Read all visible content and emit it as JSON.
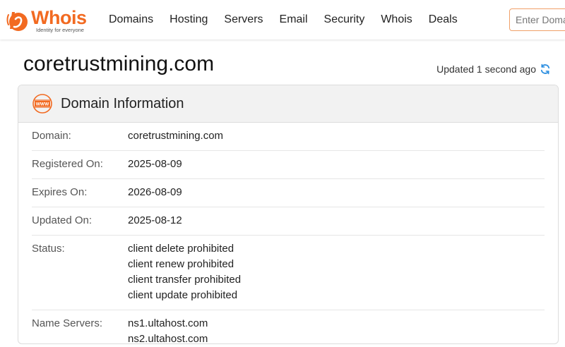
{
  "brand": {
    "name": "Whois",
    "tagline": "Identity for everyone",
    "accent_color": "#f26a21"
  },
  "nav": {
    "items": [
      {
        "label": "Domains"
      },
      {
        "label": "Hosting"
      },
      {
        "label": "Servers"
      },
      {
        "label": "Email"
      },
      {
        "label": "Security"
      },
      {
        "label": "Whois"
      },
      {
        "label": "Deals"
      }
    ],
    "search_placeholder": "Enter Domain"
  },
  "page": {
    "title": "coretrustmining.com",
    "updated_text": "Updated 1 second ago",
    "refresh_icon": "refresh-icon"
  },
  "card": {
    "title": "Domain Information",
    "icon": "www-icon",
    "rows": [
      {
        "label": "Domain:",
        "values": [
          "coretrustmining.com"
        ]
      },
      {
        "label": "Registered On:",
        "values": [
          "2025-08-09"
        ]
      },
      {
        "label": "Expires On:",
        "values": [
          "2026-08-09"
        ]
      },
      {
        "label": "Updated On:",
        "values": [
          "2025-08-12"
        ]
      },
      {
        "label": "Status:",
        "values": [
          "client delete prohibited",
          "client renew prohibited",
          "client transfer prohibited",
          "client update prohibited"
        ]
      },
      {
        "label": "Name Servers:",
        "values": [
          "ns1.ultahost.com",
          "ns2.ultahost.com"
        ]
      }
    ]
  }
}
